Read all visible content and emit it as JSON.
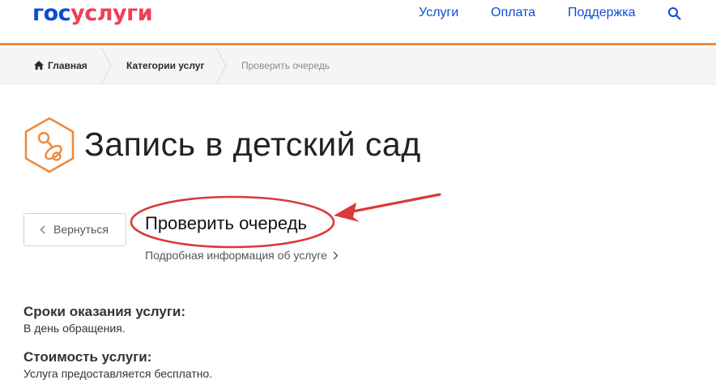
{
  "header": {
    "logo_part1": "гос",
    "logo_part2": "услуги",
    "nav": [
      "Услуги",
      "Оплата",
      "Поддержка"
    ],
    "colors": {
      "brand_blue": "#0d4cd3",
      "brand_red": "#ee3f58",
      "accent_orange": "#ee8a3c"
    }
  },
  "breadcrumb": {
    "items": [
      "Главная",
      "Категории услуг",
      "Проверить очередь"
    ]
  },
  "page": {
    "title": "Запись в детский сад",
    "back_label": "Вернуться",
    "service_title": "Проверить очередь",
    "more_info": "Подробная информация об услуге"
  },
  "sections": [
    {
      "heading": "Сроки оказания услуги:",
      "text": "В день обращения."
    },
    {
      "heading": "Стоимость услуги:",
      "text": "Услуга предоставляется бесплатно."
    }
  ],
  "annotation": {
    "color": "#d93a3a"
  }
}
